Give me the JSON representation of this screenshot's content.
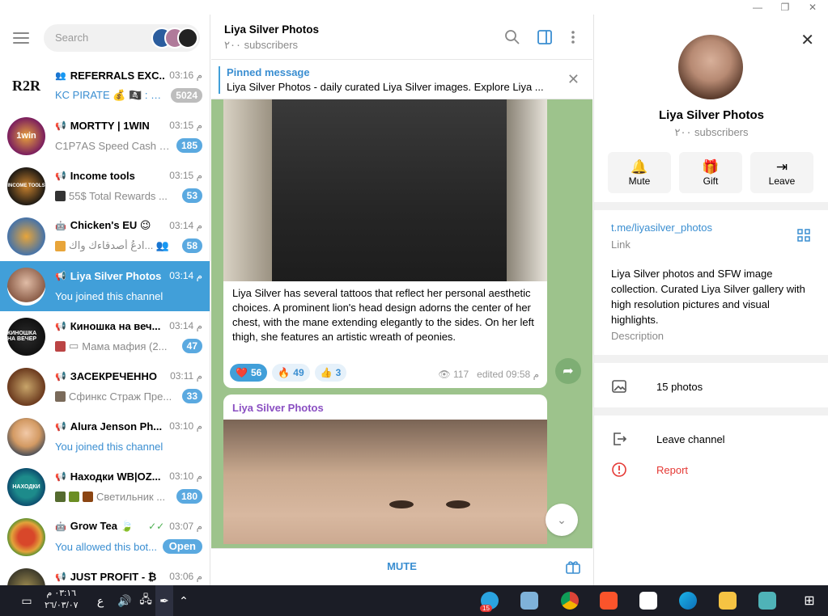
{
  "search": {
    "placeholder": "Search"
  },
  "chats": [
    {
      "title": "REFERRALS EXC...",
      "time": "03:16 م",
      "preview": "KC PIRATE 💰 🏴‍☠️ : ht...",
      "badge": "5024",
      "badge_style": "grey",
      "icon": "group-icon",
      "avatar_text": "R2R"
    },
    {
      "title": "MORTTY | 1WIN",
      "time": "03:15 م",
      "preview": "C1P7AS Speed Cash XOF",
      "badge": "185",
      "icon": "channel-icon",
      "avatar_text": "1win"
    },
    {
      "title": "Income tools",
      "time": "03:15 م",
      "preview": "55$ Total Rewards ...",
      "badge": "53",
      "icon": "channel-icon",
      "avatar_text": "INCOME TOOLS"
    },
    {
      "title": "Chicken's EU 😉",
      "time": "03:14 م",
      "preview": "ادعُ أصدقاءك واك... 👥",
      "badge": "58",
      "icon": "bot-icon",
      "avatar_text": ""
    },
    {
      "title": "Liya Silver Photos",
      "time": "03:14 م",
      "preview": "You joined this channel",
      "badge": "",
      "icon": "channel-icon",
      "avatar_text": ""
    },
    {
      "title": "Киношка на веч...",
      "time": "03:14 م",
      "preview": "Мама мафия (2...",
      "badge": "47",
      "icon": "channel-icon",
      "avatar_text": "КИНОШКА НА ВЕЧЕР"
    },
    {
      "title": "ЗАСЕКРЕЧЕННО",
      "time": "03:11 م",
      "preview": "Сфинкс Страж Пре...",
      "badge": "33",
      "icon": "channel-icon",
      "avatar_text": ""
    },
    {
      "title": "Alura Jenson Ph...",
      "time": "03:10 م",
      "preview": "You joined this channel",
      "badge": "",
      "icon": "channel-icon",
      "avatar_text": ""
    },
    {
      "title": "Находки WB|OZ...",
      "time": "03:10 م",
      "preview": "Светильник ...",
      "badge": "180",
      "icon": "channel-icon",
      "avatar_text": "НАХОДКИ"
    },
    {
      "title": "Grow Tea 🍃",
      "time": "03:07 م",
      "preview": "You allowed this bot...",
      "badge": "Open",
      "icon": "bot-icon",
      "avatar_text": ""
    },
    {
      "title": "JUST PROFIT - ₿",
      "time": "03:06 م",
      "preview": "",
      "badge": "",
      "icon": "channel-icon",
      "avatar_text": ""
    }
  ],
  "header": {
    "title": "Liya Silver Photos",
    "subtitle": "٢٠٠ subscribers"
  },
  "pinned": {
    "label": "Pinned message",
    "text": "Liya Silver Photos - daily curated Liya Silver images. Explore Liya ..."
  },
  "message1": {
    "text": "Liya Silver has several tattoos that reflect her personal aesthetic choices. A prominent lion's head design adorns the center of her chest, with the mane extending elegantly to the sides. On her left thigh, she features an artistic wreath of peonies.",
    "reactions": [
      {
        "emoji": "❤️",
        "count": "56"
      },
      {
        "emoji": "🔥",
        "count": "49"
      },
      {
        "emoji": "👍",
        "count": "3"
      }
    ],
    "views": "117",
    "edited": "edited 09:58 م"
  },
  "message2": {
    "sender": "Liya Silver Photos"
  },
  "footer": {
    "mute": "MUTE"
  },
  "profile": {
    "name": "Liya Silver Photos",
    "subtitle": "٢٠٠ subscribers",
    "actions": {
      "mute": "Mute",
      "gift": "Gift",
      "leave": "Leave"
    },
    "link": "t.me/liyasilver_photos",
    "link_label": "Link",
    "description": "Liya Silver photos and SFW image collection. Curated Liya Silver gallery with high resolution pictures and visual highlights.",
    "description_label": "Description",
    "photos": "15 photos",
    "leave_channel": "Leave channel",
    "report": "Report"
  },
  "taskbar": {
    "time": "٠٣:١٦ م",
    "date": "٢٦/٠٣/٠٧",
    "lang": "ع",
    "tg_badge": "15"
  },
  "colors": {
    "accent": "#419fd9",
    "chat_bg": "#9dc38c",
    "report": "#e53935",
    "taskbar": "#1b1d26"
  }
}
